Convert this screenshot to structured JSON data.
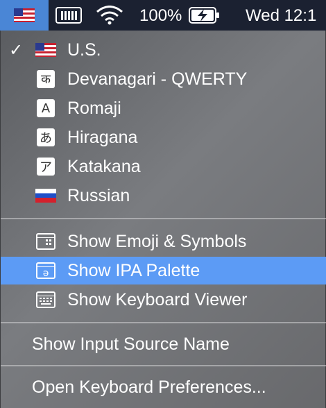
{
  "menubar": {
    "flag_icon": "us-flag-icon",
    "battery_percent": "100%",
    "clock": "Wed 12:1"
  },
  "menu": {
    "sources": [
      {
        "label": "U.S.",
        "icon": "us-flag-icon",
        "checked": true
      },
      {
        "label": "Devanagari - QWERTY",
        "glyph": "क",
        "icon": "devanagari-icon"
      },
      {
        "label": "Romaji",
        "glyph": "A",
        "icon": "romaji-icon"
      },
      {
        "label": "Hiragana",
        "glyph": "あ",
        "icon": "hiragana-icon"
      },
      {
        "label": "Katakana",
        "glyph": "ア",
        "icon": "katakana-icon"
      },
      {
        "label": "Russian",
        "icon": "russia-flag-icon"
      }
    ],
    "tools": [
      {
        "label": "Show Emoji & Symbols",
        "icon": "emoji-symbols-icon"
      },
      {
        "label": "Show IPA Palette",
        "icon": "ipa-palette-icon",
        "highlighted": true
      },
      {
        "label": "Show Keyboard Viewer",
        "icon": "keyboard-viewer-icon"
      }
    ],
    "show_input_source_name": "Show Input Source Name",
    "open_keyboard_preferences": "Open Keyboard Preferences...",
    "check_glyph": "✓"
  },
  "colors": {
    "menubar_bg": "#1b2131",
    "highlight": "#5c9bf5",
    "flag_selected_bg": "#4a86d6"
  }
}
